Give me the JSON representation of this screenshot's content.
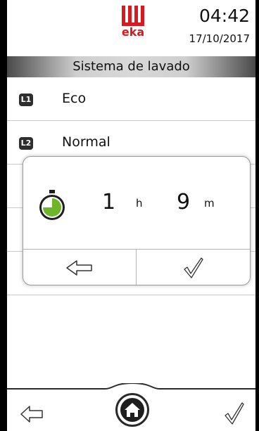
{
  "header": {
    "logo_text": "eka",
    "time": "04:42",
    "date": "17/10/2017"
  },
  "title": "Sistema de lavado",
  "programs": [
    {
      "badge": "L1",
      "label": "Eco"
    },
    {
      "badge": "L2",
      "label": "Normal"
    }
  ],
  "timer_dialog": {
    "hours": "1",
    "hours_unit": "h",
    "minutes": "9",
    "minutes_unit": "m",
    "timer_icon": "timer-icon",
    "timer_progress": 0.75,
    "back_icon": "arrow-left-icon",
    "confirm_icon": "checkmark-icon"
  },
  "bottom_nav": {
    "back_icon": "arrow-left-icon",
    "home_icon": "home-icon",
    "confirm_icon": "checkmark-icon"
  },
  "colors": {
    "brand_red": "#d71920",
    "timer_green": "#6fb52c",
    "frame": "#000000"
  }
}
